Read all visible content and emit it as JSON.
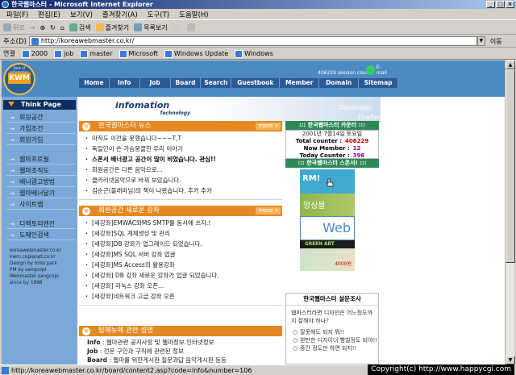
{
  "window": {
    "title": "한국웹마스터 - Microsoft Internet Explorer"
  },
  "menu": [
    "파일(F)",
    "편집(E)",
    "보기(V)",
    "즐겨찾기(A)",
    "도구(T)",
    "도움말(H)"
  ],
  "toolbar": {
    "back": "뒤로",
    "forward": "→",
    "stop": "⊗",
    "refresh": "↻",
    "home": "⌂",
    "search": "검색",
    "favorites": "즐겨찾기",
    "history": "목록보기"
  },
  "address": {
    "label": "주소(D)",
    "url": "http://koreawebmaster.co.kr/",
    "go": "이동"
  },
  "links": {
    "label": "연결",
    "items": [
      "2000",
      "job",
      "master",
      "Microsoft",
      "Windows Update",
      "Windows"
    ]
  },
  "site": {
    "logo_top": "Best of Information",
    "logo": "KWM",
    "counter_text": "406229 session count",
    "email": "E-mail",
    "nav": [
      "Home",
      "Info",
      "Job",
      "Board",
      "Search",
      "Guestbook",
      "Member",
      "Domain",
      "Sitemap"
    ],
    "banner": {
      "t1": "infomation",
      "t2": "Technology",
      "t3": "Developer",
      "t4": "Drafter"
    },
    "sidebar": {
      "head": "Think Page",
      "items": [
        "회원공간",
        "가입조건",
        "회원가입",
        "웹마프로필",
        "웹마조직도",
        "배너광고방법",
        "웹마배너달기",
        "사이트맵",
        "디렉토리엔진",
        "도메인검색"
      ],
      "info": [
        "koreawebmaster.co.kr",
        "kwm.copianet.co.kr",
        "Design by miss park",
        "PM by sangcopi",
        "Webmaster sangcopi",
        "since by 1998"
      ]
    },
    "news": {
      "title": "한국웹마스터 뉴스",
      "more": "more »",
      "items": [
        "마직도 이전을 못했습니다~~~T,T",
        "독일인이 쓴 가슴뭉클한 우리 이야기",
        "스폰서 배너광고 공간이 많이 비었습니다. 관심!!",
        "회원공간은 다른 음악으로...",
        "클라리넷음악으로 바꿔 보았습니다.",
        "김순근(블래마님)의 책이 나왔습니다. 추카 추카"
      ]
    },
    "lecture": {
      "title": "회원공간 새로운 강좌",
      "more": "more »",
      "items": [
        "[새강좌]EMWAC와MS SMTP를 동시에 쓰자.!",
        "[새강좌]SQL 계체생성 및 관리",
        "[새강좌]DB 강좌가 업그레이드 되었습니다.",
        "[새강좌]MS SQL 서버 강좌 업글",
        "[새강좌]MS Access의 활용강좌",
        "[새강좌] DB 강좌 새로운 강좌가 업글 되었습니다.",
        "[새강좌] 리눅스 강좌 오픈...",
        "[새강좌]네트워크 고급 강좌 오픈"
      ]
    },
    "menuinfo": {
      "title": "탑메뉴에 관한 설명",
      "rows": [
        {
          "k": "Info",
          "v": "웹마관련 공지사항 및 웹마정보.인터넷정보"
        },
        {
          "k": "Job",
          "v": "전문 구인과 구직에 관련된 정보"
        },
        {
          "k": "Board",
          "v": "웹마를 위한게시판 질문과답 음악게시판 등등"
        }
      ]
    },
    "counterbox": {
      "title": "::: 한국웹마스터 카운터 :::",
      "date": "2001년 7월14일 토요일",
      "rows": [
        {
          "k": "Total counter :",
          "v": "406229"
        },
        {
          "k": "Now Member :",
          "v": "12"
        },
        {
          "k": "Today Counter :",
          "v": "396"
        }
      ]
    },
    "sponsor": {
      "title": "::: 한국웹마스터 스폰서! :::",
      "ads": [
        "RM!",
        "앙상블",
        "Web",
        "GREEN ART SCHOOL",
        "4000원"
      ]
    },
    "survey": {
      "title": "한국웹마스터 설문조사",
      "question": "웹마스터라면 디자인은 어느정도까지 잘해야 하나?",
      "options": [
        "잘못해도 되지 뭐!!",
        "완만한 디자이너 뺨칠정도 되야!!",
        "중간 정도만 하면 되지!!"
      ]
    }
  },
  "status": {
    "text": "http://koreawebmaster.co.kr/board/content2.asp?code=info&number=106",
    "copyright": "Copyright(c) http://www.happycgi.com"
  }
}
